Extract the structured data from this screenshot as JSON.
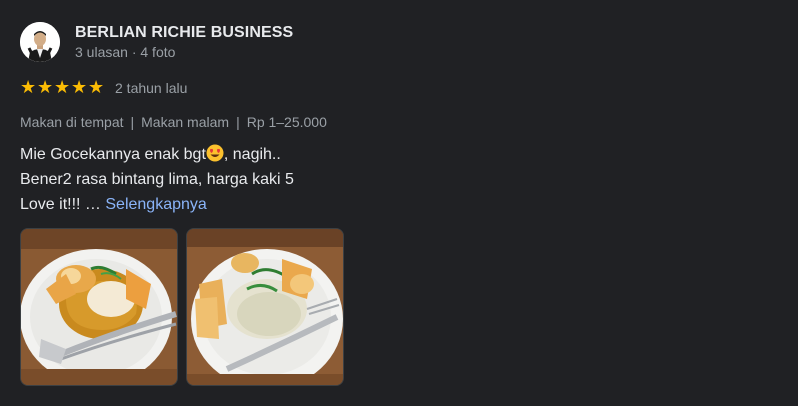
{
  "review": {
    "author_name": "BERLIAN RICHIE BUSINESS",
    "author_meta": "3 ulasan · 4 foto",
    "rating": 5,
    "rating_max": 5,
    "time": "2 tahun lalu",
    "tags": [
      "Makan di tempat",
      "Makan malam",
      "Rp 1–25.000"
    ],
    "text_line1_a": "Mie Gocekannya enak bgt",
    "text_line1_b": ", nagih..",
    "text_line2": "Bener2 rasa bintang lima, harga kaki 5",
    "text_line3": "Love it!!! …",
    "more_label": "Selengkapnya",
    "emoji": "heart-eyes-emoji",
    "photos": [
      {
        "name": "food-photo-1"
      },
      {
        "name": "food-photo-2"
      }
    ]
  },
  "colors": {
    "background": "#202124",
    "star": "#fbbc04",
    "link": "#8ab4f8",
    "muted": "#9aa0a6"
  }
}
